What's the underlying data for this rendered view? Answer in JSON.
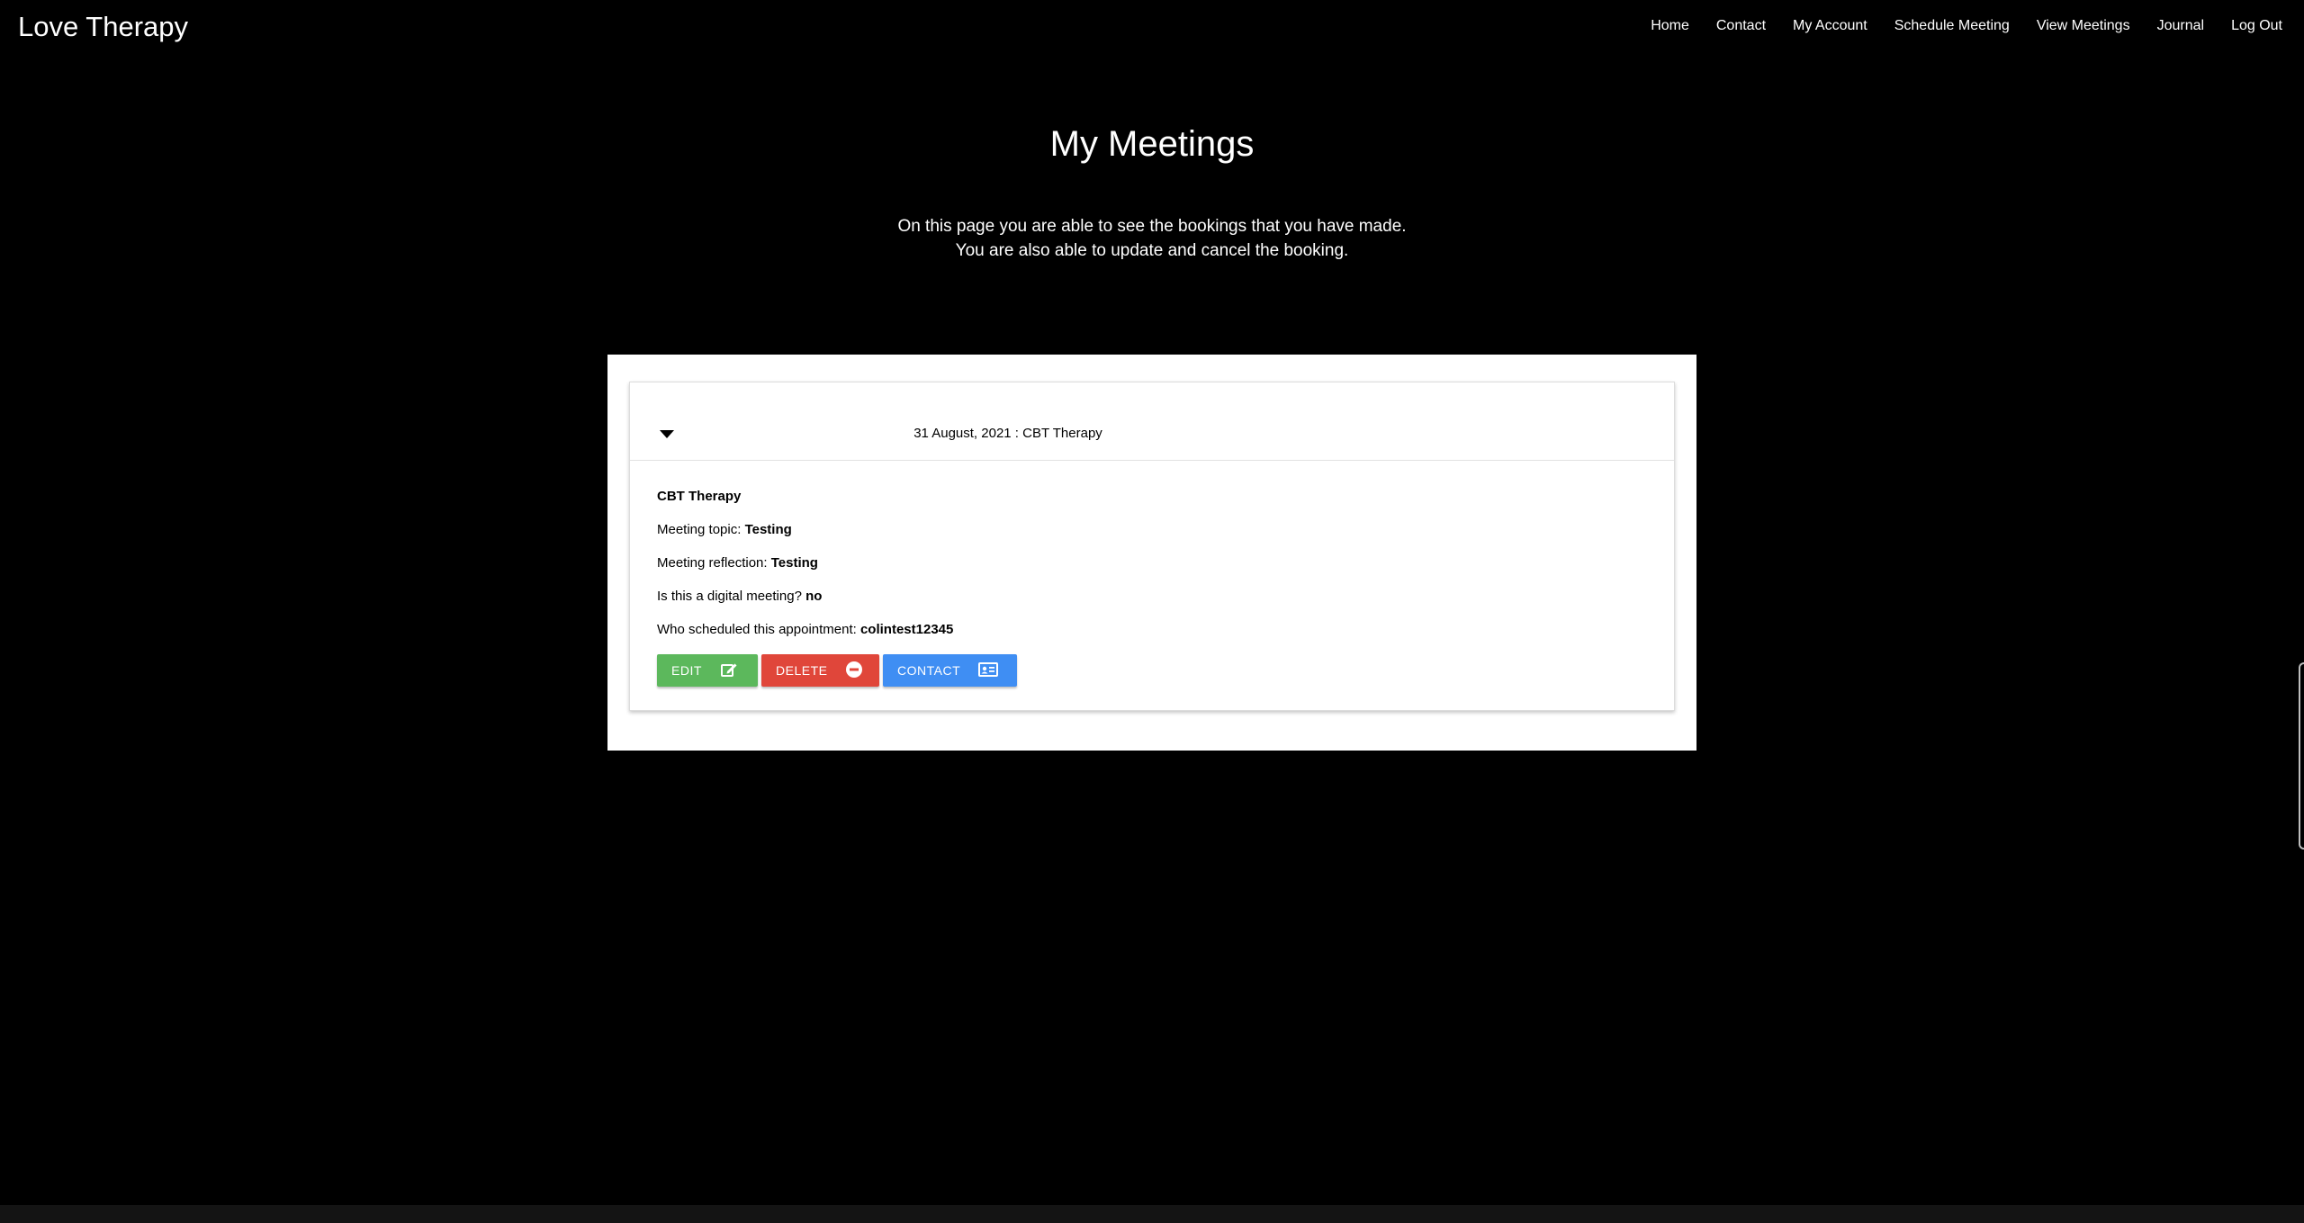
{
  "brand": "Love Therapy",
  "nav": [
    {
      "label": "Home"
    },
    {
      "label": "Contact"
    },
    {
      "label": "My Account"
    },
    {
      "label": "Schedule Meeting"
    },
    {
      "label": "View Meetings"
    },
    {
      "label": "Journal"
    },
    {
      "label": "Log Out"
    }
  ],
  "page": {
    "title": "My Meetings",
    "intro_line1": "On this page you are able to see the bookings that you have made.",
    "intro_line2": "You are also able to update and cancel the booking."
  },
  "meeting": {
    "header_date": "31 August, 2021 :",
    "header_type": " CBT Therapy",
    "name": "CBT Therapy",
    "topic_label": "Meeting topic: ",
    "topic_value": "Testing",
    "reflection_label": "Meeting reflection: ",
    "reflection_value": "Testing",
    "digital_label": "Is this a digital meeting? ",
    "digital_value": "no",
    "scheduler_label": "Who scheduled this appointment: ",
    "scheduler_value": "colintest12345"
  },
  "actions": {
    "edit_label": "EDIT",
    "edit_icon": "edit-icon",
    "delete_label": "DELETE",
    "delete_icon": "minus-circle-icon",
    "contact_label": "CONTACT",
    "contact_icon": "contact-card-icon"
  },
  "colors": {
    "background": "#000000",
    "edit": "#5cb85c",
    "delete": "#e0463a",
    "contact": "#3f8ef3"
  }
}
